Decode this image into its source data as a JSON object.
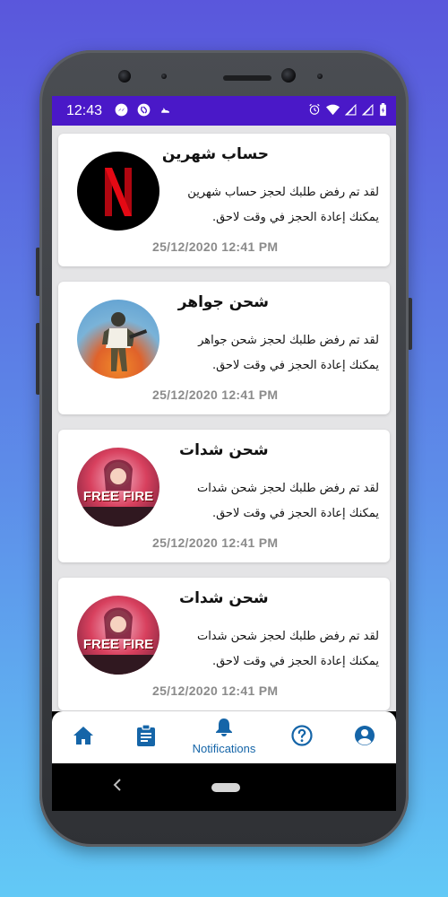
{
  "status_bar": {
    "time": "12:43",
    "colors": {
      "bar": "#4a18c8"
    }
  },
  "notifications": [
    {
      "title": "حساب شهرين",
      "message_line1": "لقد تم رفض طلبك لحجز حساب شهرين",
      "message_line2": "يمكنك إعادة الحجز في وقت لاحق.",
      "date": "25/12/2020 12:41 PM",
      "avatar_icon": "netflix-logo"
    },
    {
      "title": "شحن جواهر",
      "message_line1": "لقد تم رفض طلبك لحجز شحن جواهر",
      "message_line2": "يمكنك إعادة الحجز في وقت لاحق.",
      "date": "25/12/2020 12:41 PM",
      "avatar_icon": "pubg-character-image"
    },
    {
      "title": "شحن شدات",
      "message_line1": "لقد تم رفض طلبك لحجز شحن شدات",
      "message_line2": "يمكنك إعادة الحجز في وقت لاحق.",
      "date": "25/12/2020 12:41 PM",
      "avatar_icon": "free-fire-logo",
      "avatar_text": "FREE FIRE"
    },
    {
      "title": "شحن شدات",
      "message_line1": "لقد تم رفض طلبك لحجز شحن شدات",
      "message_line2": "يمكنك إعادة الحجز في وقت لاحق.",
      "date": "25/12/2020 12:41 PM",
      "avatar_icon": "free-fire-logo",
      "avatar_text": "FREE FIRE"
    }
  ],
  "bottom_nav": {
    "items": [
      {
        "icon": "home-icon"
      },
      {
        "icon": "clipboard-icon"
      },
      {
        "icon": "bell-icon",
        "label": "Notifications",
        "active": true
      },
      {
        "icon": "help-icon"
      },
      {
        "icon": "account-icon"
      }
    ],
    "accent": "#1565a8"
  }
}
